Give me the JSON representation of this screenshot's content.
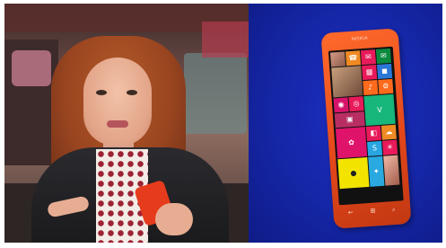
{
  "video": {
    "description_free": true
  },
  "phone": {
    "brand": "NOKIA",
    "tiles": [
      {
        "name": "people-tile",
        "color": "#d8d8d8",
        "kind": "photo",
        "w": 1,
        "h": 1,
        "icon": ""
      },
      {
        "name": "phone-tile",
        "color": "#f08a24",
        "kind": "icon",
        "w": 1,
        "h": 1,
        "icon": "☎"
      },
      {
        "name": "messaging-tile",
        "color": "#e81a5a",
        "kind": "icon",
        "w": 1,
        "h": 1,
        "icon": "✉"
      },
      {
        "name": "mail-tile",
        "color": "#0b8a3e",
        "kind": "icon",
        "w": 1,
        "h": 1,
        "icon": "✉"
      },
      {
        "name": "photos-tile",
        "color": "#ffffff",
        "kind": "photo2",
        "w": 2,
        "h": 2,
        "icon": ""
      },
      {
        "name": "calendar-tile",
        "color": "#e81a5a",
        "kind": "icon",
        "w": 1,
        "h": 1,
        "icon": "▦"
      },
      {
        "name": "store-tile",
        "color": "#2b77d6",
        "kind": "icon",
        "w": 1,
        "h": 1,
        "icon": "◼"
      },
      {
        "name": "music-tile",
        "color": "#ff6a1c",
        "kind": "icon",
        "w": 1,
        "h": 1,
        "icon": "♪"
      },
      {
        "name": "settings-tile",
        "color": "#ff6a1c",
        "kind": "icon",
        "w": 1,
        "h": 1,
        "icon": "⚙"
      },
      {
        "name": "camera-tile",
        "color": "#d6136b",
        "kind": "icon",
        "w": 1,
        "h": 1,
        "icon": "◉"
      },
      {
        "name": "instagram-tile",
        "color": "#e81a5a",
        "kind": "icon",
        "w": 1,
        "h": 1,
        "icon": "◎"
      },
      {
        "name": "vine-tile",
        "color": "#17b67a",
        "kind": "icon",
        "w": 2,
        "h": 2,
        "icon": "V"
      },
      {
        "name": "photo-app-tile",
        "color": "#b82d64",
        "kind": "icon",
        "w": 2,
        "h": 1,
        "icon": "▣"
      },
      {
        "name": "foursquare-tile",
        "color": "#e0136b",
        "kind": "icon",
        "w": 2,
        "h": 2,
        "icon": "✿"
      },
      {
        "name": "office-tile",
        "color": "#e81a5a",
        "kind": "icon",
        "w": 1,
        "h": 1,
        "icon": "◧"
      },
      {
        "name": "onedrive-tile",
        "color": "#f08a24",
        "kind": "icon",
        "w": 1,
        "h": 1,
        "icon": "☁"
      },
      {
        "name": "skype-tile",
        "color": "#27a6e0",
        "kind": "icon",
        "w": 1,
        "h": 1,
        "icon": "S"
      },
      {
        "name": "weather-tile",
        "color": "#e81a5a",
        "kind": "icon",
        "w": 1,
        "h": 1,
        "icon": "☀"
      },
      {
        "name": "yellow-app-tile",
        "color": "#f2e400",
        "kind": "icon",
        "w": 2,
        "h": 2,
        "icon": "●"
      },
      {
        "name": "twitter-tile",
        "color": "#2aa9e0",
        "kind": "icon",
        "w": 1,
        "h": 2,
        "icon": "✦"
      },
      {
        "name": "contact-photo-tile",
        "color": "#ffffff",
        "kind": "photo3",
        "w": 1,
        "h": 2,
        "icon": ""
      }
    ],
    "nav": {
      "back": "←",
      "start": "⊞",
      "search": "⌕"
    }
  },
  "colors": {
    "promo_background": "#1526a6",
    "phone_body": "#e2461a"
  }
}
